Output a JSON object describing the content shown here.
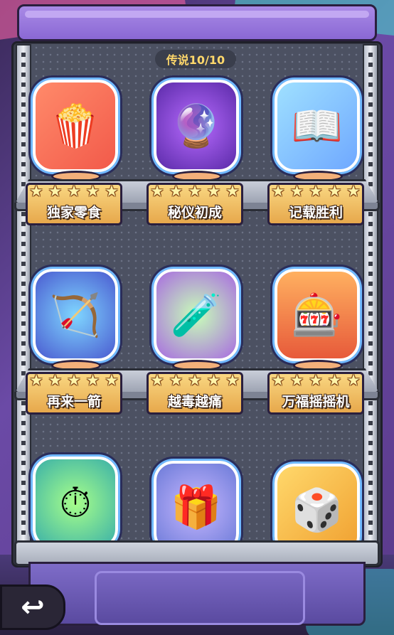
{
  "header": {
    "counter_label": "传说10/10"
  },
  "shelves": [
    {
      "items": [
        {
          "name": "独家零食",
          "icon": "popcorn-icon",
          "stars": 5
        },
        {
          "name": "秘仪初成",
          "icon": "crystal-ball-icon",
          "stars": 5
        },
        {
          "name": "记载胜利",
          "icon": "storybook-hero-icon",
          "stars": 5
        }
      ]
    },
    {
      "items": [
        {
          "name": "再来一箭",
          "icon": "bow-arrow-icon",
          "stars": 5
        },
        {
          "name": "越毒越痛",
          "icon": "poison-potion-icon",
          "stars": 5
        },
        {
          "name": "万福摇摇机",
          "icon": "slot-machine-icon",
          "stars": 5
        }
      ]
    },
    {
      "items": [
        {
          "name": "",
          "icon": "stopwatch-icon",
          "stars": 0
        },
        {
          "name": "",
          "icon": "gachapon-icon",
          "stars": 0
        },
        {
          "name": "",
          "icon": "dice-icon",
          "stars": 0
        }
      ]
    }
  ],
  "footer": {
    "back_icon": "back-arrow-icon"
  },
  "colors": {
    "counter_text": "#ffd86b",
    "plate": "#f9d782",
    "frame": "#6fb8ff"
  }
}
